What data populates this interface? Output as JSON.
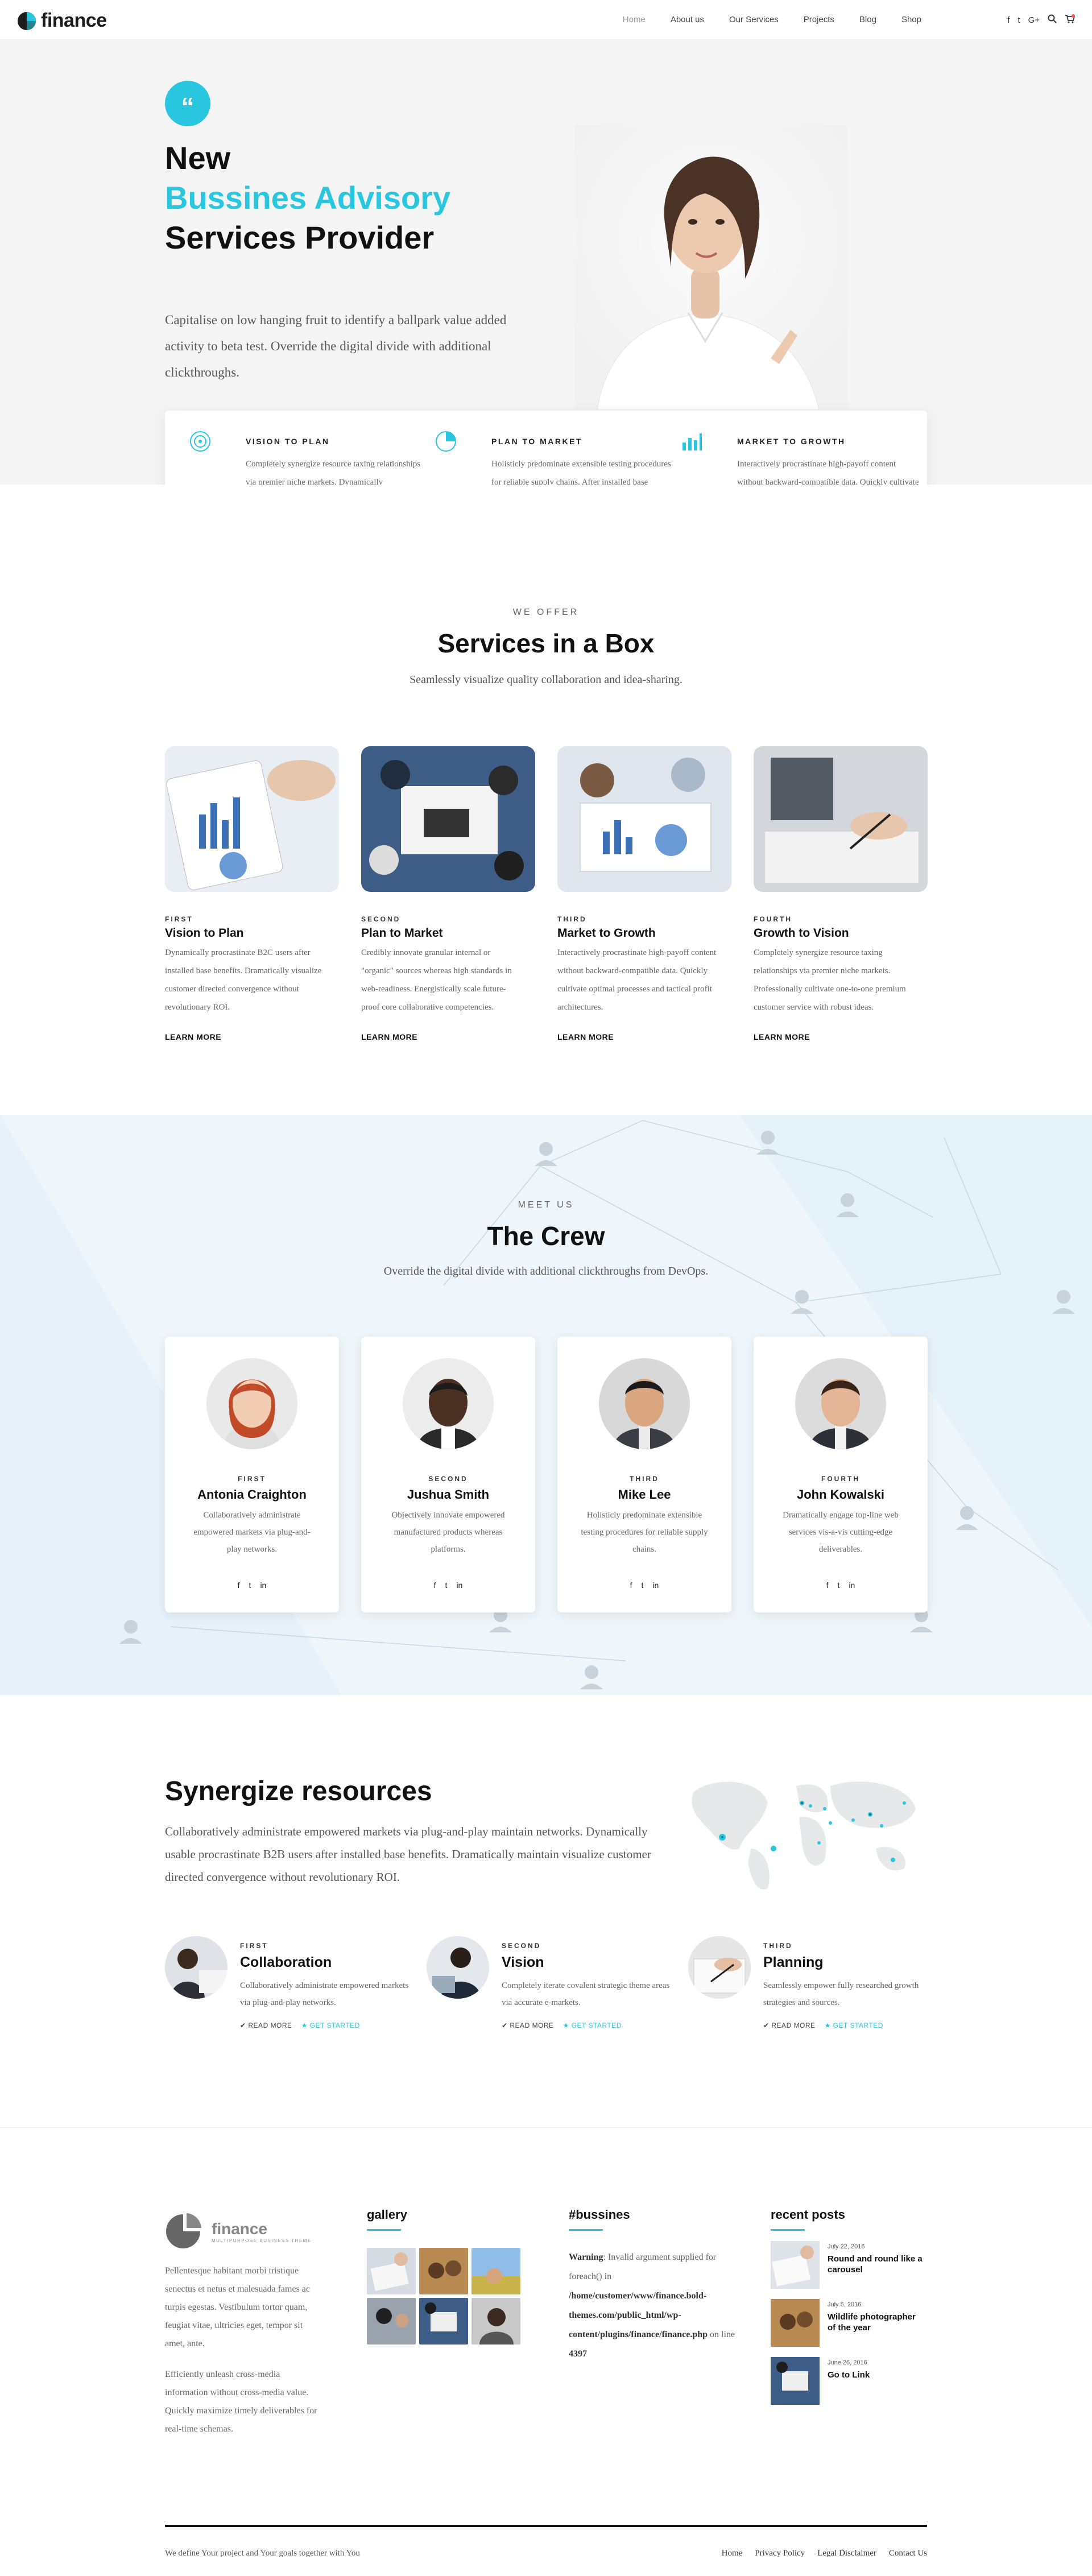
{
  "brand": {
    "name": "finance",
    "accent": "#29c6e0"
  },
  "nav": {
    "items": [
      "Home",
      "About us",
      "Our Services",
      "Projects",
      "Blog",
      "Shop"
    ],
    "social": [
      "f",
      "t",
      "G+"
    ]
  },
  "hero": {
    "line1": "New",
    "line2": "Bussines Advisory",
    "line3": "Services Provider",
    "description": "Capitalise on low hanging fruit to identify a ballpark value added activity to beta test. Override the digital divide with additional clickthroughs.",
    "features": [
      {
        "title": "VISION TO PLAN",
        "text": "Completely synergize resource taxing relationships via premier niche markets. Dynamically procrastinate users."
      },
      {
        "title": "PLAN TO MARKET",
        "text": "Holisticly predominate extensible testing procedures for reliable supply chains. After installed base benefits."
      },
      {
        "title": "MARKET TO GROWTH",
        "text": "Interactively procrastinate high-payoff content without backward-compatible data. Quickly cultivate optimal processes."
      }
    ]
  },
  "services": {
    "eyebrow": "WE OFFER",
    "title": "Services in a Box",
    "subtitle": "Seamlessly visualize quality collaboration and idea-sharing.",
    "cards": [
      {
        "num": "FIRST",
        "title": "Vision to Plan",
        "text": "Dynamically procrastinate B2C users after installed base benefits. Dramatically visualize customer directed convergence without revolutionary ROI.",
        "more": "LEARN MORE"
      },
      {
        "num": "SECOND",
        "title": "Plan to Market",
        "text": "Credibly innovate granular internal or \"organic\" sources whereas high standards in web-readiness. Energistically scale future-proof core collaborative competencies.",
        "more": "LEARN MORE"
      },
      {
        "num": "THIRD",
        "title": "Market to Growth",
        "text": "Interactively procrastinate high-payoff content without backward-compatible data. Quickly cultivate optimal processes and tactical profit architectures.",
        "more": "LEARN MORE"
      },
      {
        "num": "FOURTH",
        "title": "Growth to Vision",
        "text": "Completely synergize resource taxing relationships via premier niche markets. Professionally cultivate one-to-one premium customer service with robust ideas.",
        "more": "LEARN MORE"
      }
    ]
  },
  "crew": {
    "eyebrow": "MEET US",
    "title": "The Crew",
    "subtitle": "Override the digital divide with additional clickthroughs from DevOps.",
    "members": [
      {
        "num": "FIRST",
        "name": "Antonia Craighton",
        "text": "Collaboratively administrate empowered markets via plug-and-play networks."
      },
      {
        "num": "SECOND",
        "name": "Jushua Smith",
        "text": "Objectively innovate empowered manufactured products whereas platforms."
      },
      {
        "num": "THIRD",
        "name": "Mike Lee",
        "text": "Holisticly predominate extensible testing procedures for reliable supply chains."
      },
      {
        "num": "FOURTH",
        "name": "John Kowalski",
        "text": "Dramatically engage top-line web services vis-a-vis cutting-edge deliverables."
      }
    ]
  },
  "synergize": {
    "title": "Synergize resources",
    "description": "Collaboratively administrate empowered markets via plug-and-play maintain networks. Dynamically usable procrastinate B2B users after installed base benefits. Dramatically maintain visualize customer directed convergence without revolutionary ROI.",
    "features": [
      {
        "num": "FIRST",
        "title": "Collaboration",
        "text": "Collaboratively administrate empowered markets via plug-and-play networks.",
        "read": "READ MORE",
        "start": "GET STARTED"
      },
      {
        "num": "SECOND",
        "title": "Vision",
        "text": "Completely iterate covalent strategic theme areas via accurate e-markets.",
        "read": "READ MORE",
        "start": "GET STARTED"
      },
      {
        "num": "THIRD",
        "title": "Planning",
        "text": "Seamlessly empower fully researched growth strategies and sources.",
        "read": "READ MORE",
        "start": "GET STARTED"
      }
    ]
  },
  "footer": {
    "logo_name": "finance",
    "logo_tag": "MULTIPURPOSE BUSINESS THEME",
    "about1": "Pellentesque habitant morbi tristique senectus et netus et malesuada fames ac turpis egestas. Vestibulum tortor quam, feugiat vitae, ultricies eget, tempor sit amet, ante.",
    "about2": "Efficiently unleash cross-media information without cross-media value. Quickly maximize timely deliverables for real-time schemas.",
    "gallery_title": "gallery",
    "bussines_title": "#bussines",
    "warning_label": "Warning",
    "warning_text": ": Invalid argument supplied for foreach() in ",
    "warning_path": "/home/customer/www/finance.bold-themes.com/public_html/wp-content/plugins/finance/finance.php",
    "warning_line_label": " on line ",
    "warning_line": "4397",
    "posts_title": "recent posts",
    "posts": [
      {
        "date": "July 22, 2016",
        "title": "Round and round like a carousel"
      },
      {
        "date": "July 5, 2016",
        "title": "Wildlife photographer of the year"
      },
      {
        "date": "June 26, 2016",
        "title": "Go to Link"
      }
    ],
    "copyright": "We define Your project and Your goals together with You",
    "links": [
      "Home",
      "Privacy Policy",
      "Legal Disclaimer",
      "Contact Us"
    ]
  }
}
